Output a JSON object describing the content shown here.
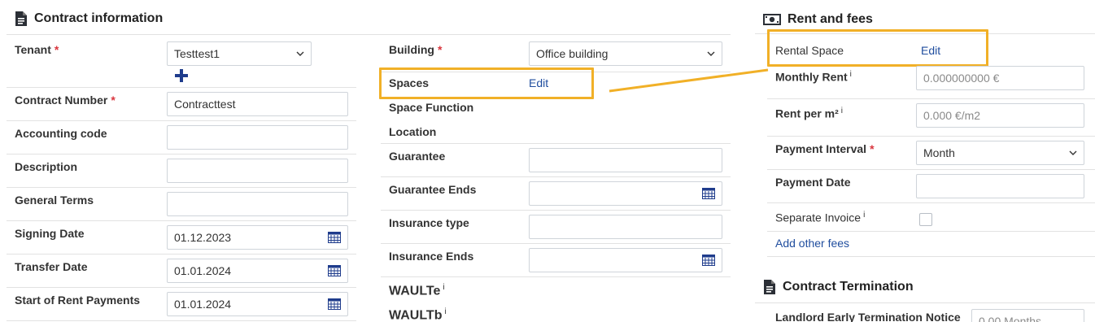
{
  "contract_info": {
    "title": "Contract information",
    "tenant": {
      "label": "Tenant",
      "value": "Testtest1"
    },
    "contract_number": {
      "label": "Contract Number",
      "value": "Contracttest"
    },
    "accounting_code": {
      "label": "Accounting code",
      "value": ""
    },
    "description": {
      "label": "Description",
      "value": ""
    },
    "general_terms": {
      "label": "General Terms",
      "value": ""
    },
    "signing_date": {
      "label": "Signing Date",
      "value": "01.12.2023"
    },
    "transfer_date": {
      "label": "Transfer Date",
      "value": "01.01.2024"
    },
    "start_rent": {
      "label": "Start of Rent Payments",
      "value": "01.01.2024"
    },
    "required_mark": "*"
  },
  "building_col": {
    "building": {
      "label": "Building",
      "value": "Office building"
    },
    "spaces": {
      "label": "Spaces",
      "link": "Edit"
    },
    "space_function": {
      "label": "Space Function"
    },
    "location": {
      "label": "Location"
    },
    "guarantee": {
      "label": "Guarantee",
      "value": ""
    },
    "guarantee_ends": {
      "label": "Guarantee Ends",
      "value": ""
    },
    "insurance_type": {
      "label": "Insurance type",
      "value": ""
    },
    "insurance_ends": {
      "label": "Insurance Ends",
      "value": ""
    },
    "waulte": {
      "label": "WAULTe",
      "info": "i"
    },
    "waultb": {
      "label": "WAULTb",
      "info": "i"
    }
  },
  "rent_fees": {
    "title": "Rent and fees",
    "rental_space": {
      "label": "Rental Space",
      "link": "Edit"
    },
    "monthly_rent": {
      "label": "Monthly Rent",
      "info": "i",
      "placeholder": "0.000000000 €"
    },
    "rent_per_m2": {
      "label": "Rent per m²",
      "info": "i",
      "placeholder": "0.000 €/m2"
    },
    "payment_interval": {
      "label": "Payment Interval",
      "value": "Month"
    },
    "payment_date": {
      "label": "Payment Date",
      "value": ""
    },
    "separate_invoice": {
      "label": "Separate Invoice",
      "info": "i",
      "checked": false
    },
    "add_fees": "Add other fees"
  },
  "termination": {
    "title": "Contract Termination",
    "landlord_notice": {
      "label": "Landlord Early Termination Notice",
      "placeholder": "0.00 Months"
    }
  },
  "colors": {
    "highlight": "#f1b027",
    "link": "#1f4d9e",
    "add_icon": "#1f3c8c",
    "required": "#d9363e"
  }
}
